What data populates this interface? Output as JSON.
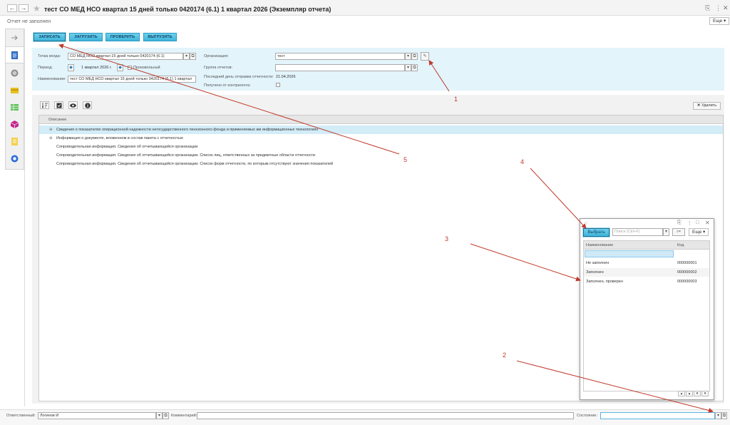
{
  "header": {
    "title": "тест СО МЕД НСО квартал 15 дней только 0420174 (6.1) 1 квартал 2026 (Экземпляр отчета)",
    "subtitle": "Отчет не заполнен",
    "more_label": "Еще"
  },
  "toolbar": {
    "save": "ЗАПИСАТЬ",
    "load": "ЗАГРУЗИТЬ",
    "check": "ПРОВЕРИТЬ",
    "export": "ВЫГРУЗИТЬ"
  },
  "form": {
    "entry_point_label": "Точка входа:",
    "entry_point_value": "СО МЕД НСО квартал 15 дней только 0420174 (6.1)",
    "period_label": "Период:",
    "period_value": "1 квартал 2026 г.",
    "period_extra": "Произвольный",
    "name_label": "Наименование:",
    "name_value": "тест СО МЕД НСО квартал 15 дней только 0420174 (6.1) 1 квартал",
    "org_label": "Организация:",
    "org_value": "тест",
    "group_label": "Группа отчетов:",
    "group_value": "",
    "last_day_label": "Последний день отправки отчетности:",
    "last_day_value": "21.04.2026",
    "received_label": "Получено от контрагента:"
  },
  "table": {
    "delete_label": "Удалить",
    "column_header": "Описание",
    "rows": [
      "Сведения о показателях операционной надежности негосударственного пенсионного фонда и применяемых им информационных технологиях",
      "Информация о документе, вложенном в состав пакета с отчетностью",
      "Сопроводительная информация. Сведения об отчитывающейся организации",
      "Сопроводительная информация. Сведения об отчитывающейся организации. Список лиц, ответственных за предметные области отчетности",
      "Сопроводительная информация. Сведения об отчитывающейся организации. Список форм отчетности, по которым отсутствуют значения показателей"
    ]
  },
  "bottom": {
    "responsible_label": "Ответственный:",
    "responsible_value": "Логинов И",
    "comment_label": "Комментарий:",
    "state_label": "Состояние:"
  },
  "popup": {
    "select_label": "Выбрать",
    "search_placeholder": "Поиск (Ctrl+F)",
    "more_label": "Еще",
    "col_name": "Наименование",
    "col_code": "Код",
    "rows": [
      {
        "name": "Не заполнен",
        "code": "000000001"
      },
      {
        "name": "Заполнен",
        "code": "000000002"
      },
      {
        "name": "Заполнен, проверен",
        "code": "000000003"
      }
    ]
  },
  "annotations": {
    "a1": "1",
    "a2": "2",
    "a3": "3",
    "a4": "4",
    "a5": "5",
    "color": "#c0392b"
  }
}
